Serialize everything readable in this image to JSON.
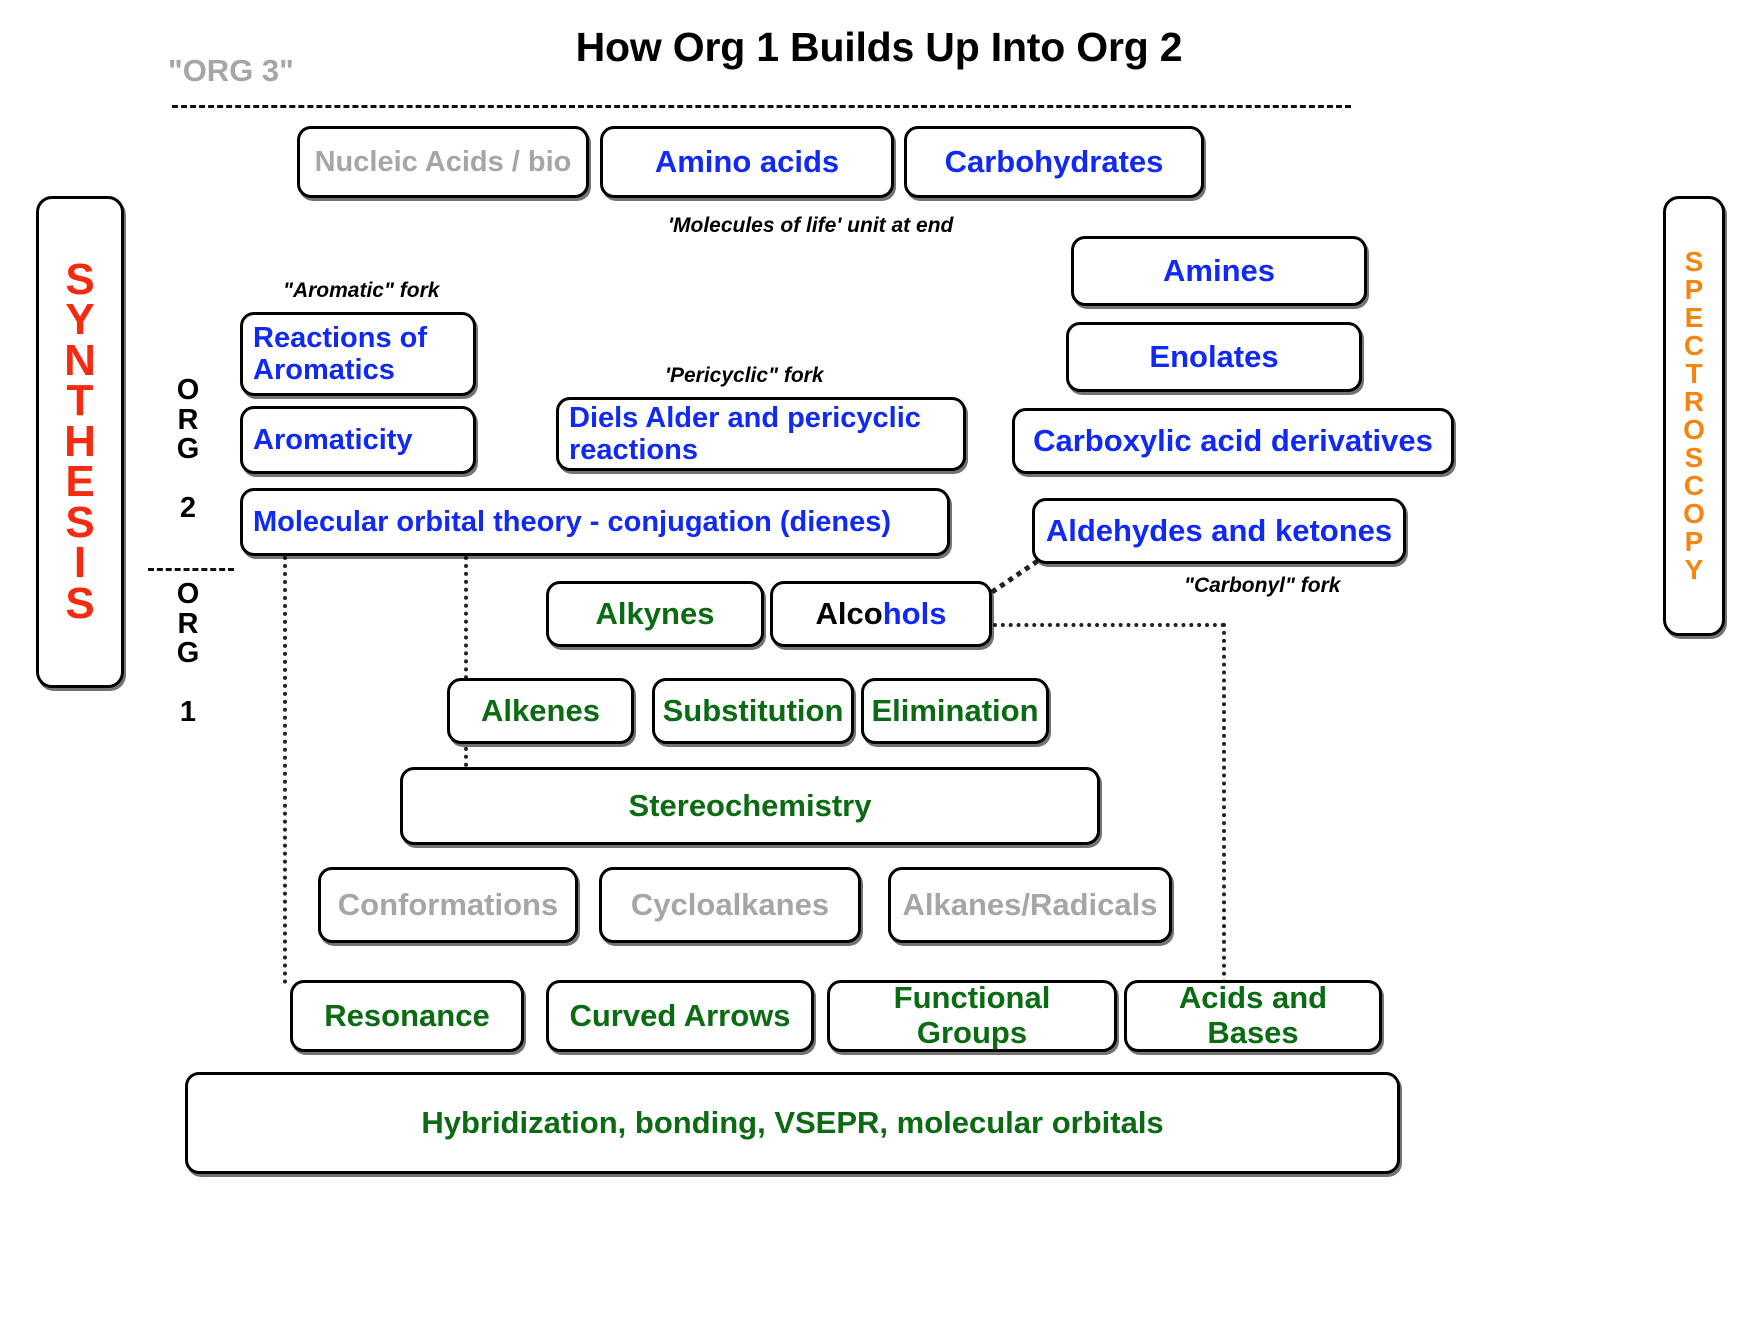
{
  "title": "How Org 1 Builds Up Into Org 2",
  "org3_label": "\"ORG 3\"",
  "colors": {
    "org2_blue": "#1029f5",
    "org1_green": "#0a6b12",
    "deemphasized_gray": "#a6a6a6",
    "synthesis_red": "#f42b11",
    "spectroscopy_orange": "#f58410",
    "box_border": "#000000",
    "background": "#ffffff"
  },
  "rails": {
    "left": {
      "text": "SYNTHESIS",
      "color": "#f42b11"
    },
    "right": {
      "text": "SPECTROSCOPY",
      "color": "#f58410"
    }
  },
  "tier_labels": {
    "org2": "ORG 2",
    "org1": "ORG 1"
  },
  "captions": {
    "molecules_of_life": "'Molecules of life' unit at end",
    "aromatic_fork": "\"Aromatic\" fork",
    "pericyclic_fork": "'Pericyclic\" fork",
    "carbonyl_fork": "\"Carbonyl\" fork"
  },
  "boxes": {
    "nucleic_acids": "Nucleic Acids / bio",
    "amino_acids": "Amino acids",
    "carbohydrates": "Carbohydrates",
    "amines": "Amines",
    "enolates": "Enolates",
    "carboxylic_acid_derivatives": "Carboxylic acid derivatives",
    "aldehydes_and_ketones": "Aldehydes and ketones",
    "reactions_of_aromatics": "Reactions of Aromatics",
    "aromaticity": "Aromaticity",
    "diels_alder": "Diels Alder and pericyclic reactions",
    "molecular_orbital_theory": "Molecular orbital theory - conjugation (dienes)",
    "alkynes": "Alkynes",
    "alcohols_part1": "Alco",
    "alcohols_part2": "hols",
    "alkenes": "Alkenes",
    "substitution": "Substitution",
    "elimination": "Elimination",
    "stereochemistry": "Stereochemistry",
    "conformations": "Conformations",
    "cycloalkanes": "Cycloalkanes",
    "alkanes_radicals": "Alkanes/Radicals",
    "resonance": "Resonance",
    "curved_arrows": "Curved Arrows",
    "functional_groups": "Functional Groups",
    "acids_and_bases": "Acids and Bases",
    "hybridization": "Hybridization, bonding, VSEPR, molecular orbitals"
  }
}
